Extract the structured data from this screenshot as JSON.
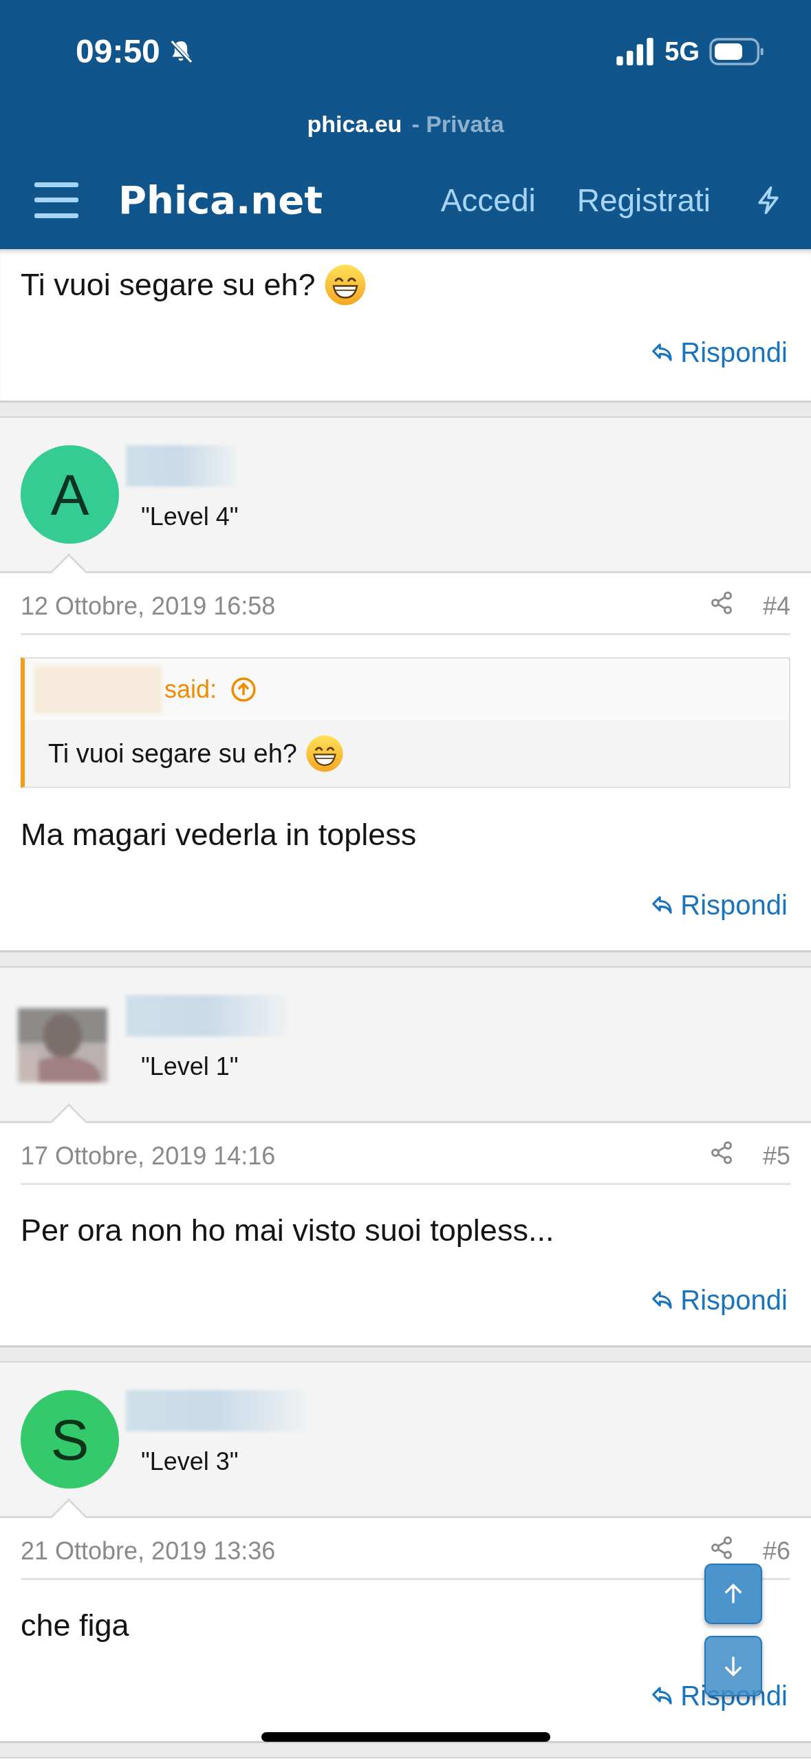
{
  "status_bar": {
    "time": "09:50",
    "network": "5G"
  },
  "browser": {
    "domain": "phica.eu",
    "mode": "- Privata"
  },
  "nav": {
    "logo": "Phica.net",
    "links": [
      "Accedi",
      "Registrati"
    ]
  },
  "first_post": {
    "body": "Ti vuoi segare su eh?",
    "emoji": true,
    "reply": "Rispondi"
  },
  "posts": [
    {
      "avatar": {
        "kind": "letter",
        "letter": "A",
        "color": "#35cc94"
      },
      "level": "\"Level 4\"",
      "date": "12 Ottobre, 2019 16:58",
      "number": "#4",
      "quote": {
        "said": "said:",
        "body": "Ti vuoi segare su eh?",
        "emoji": true
      },
      "body": "Ma magari vederla in topless",
      "reply": "Rispondi"
    },
    {
      "level": "\"Level 1\"",
      "date": "17 Ottobre, 2019 14:16",
      "number": "#5",
      "body": "Per ora non ho mai visto suoi topless...",
      "reply": "Rispondi"
    },
    {
      "avatar": {
        "kind": "letter",
        "letter": "S",
        "color": "#34c96b"
      },
      "level": "\"Level 3\"",
      "date": "21 Ottobre, 2019 13:36",
      "number": "#6",
      "body": "che figa",
      "reply": "Rispondi"
    }
  ]
}
